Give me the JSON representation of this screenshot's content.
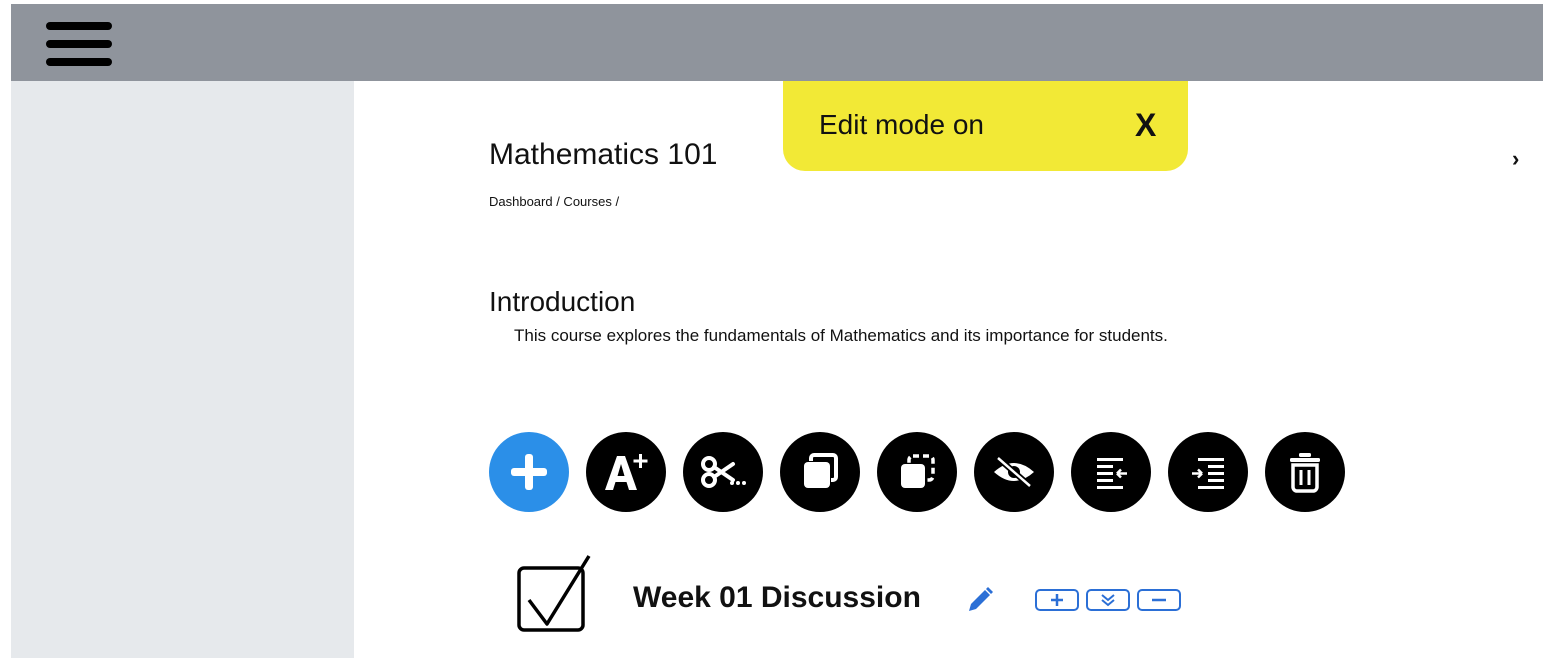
{
  "topbar": {
    "menu_icon": "hamburger-menu-icon"
  },
  "toast": {
    "text": "Edit mode on",
    "close_label": "X"
  },
  "course": {
    "title": "Mathematics 101",
    "breadcrumb": "Dashboard / Courses /"
  },
  "edge_glyph": "›",
  "section": {
    "heading": "Introduction",
    "description": "This course explores the fundamentals of Mathematics and its importance for students."
  },
  "toolbar": {
    "buttons": [
      {
        "icon": "plus-icon",
        "color": "#2b8fe8"
      },
      {
        "icon": "font-increase-icon",
        "color": "#000000"
      },
      {
        "icon": "scissors-icon",
        "color": "#000000"
      },
      {
        "icon": "copy-icon",
        "color": "#000000"
      },
      {
        "icon": "duplicate-icon",
        "color": "#000000"
      },
      {
        "icon": "eye-off-icon",
        "color": "#000000"
      },
      {
        "icon": "outdent-icon",
        "color": "#000000"
      },
      {
        "icon": "indent-icon",
        "color": "#000000"
      },
      {
        "icon": "trash-icon",
        "color": "#000000"
      }
    ]
  },
  "activity": {
    "title": "Week 01 Discussion",
    "icon": "checkbox-icon",
    "controls": [
      "add-icon",
      "expand-icon",
      "minus-icon"
    ]
  },
  "colors": {
    "topbar": "#8f949c",
    "sidebar": "#e6e9ec",
    "toast": "#f2e936",
    "accent": "#2b8fe8"
  }
}
